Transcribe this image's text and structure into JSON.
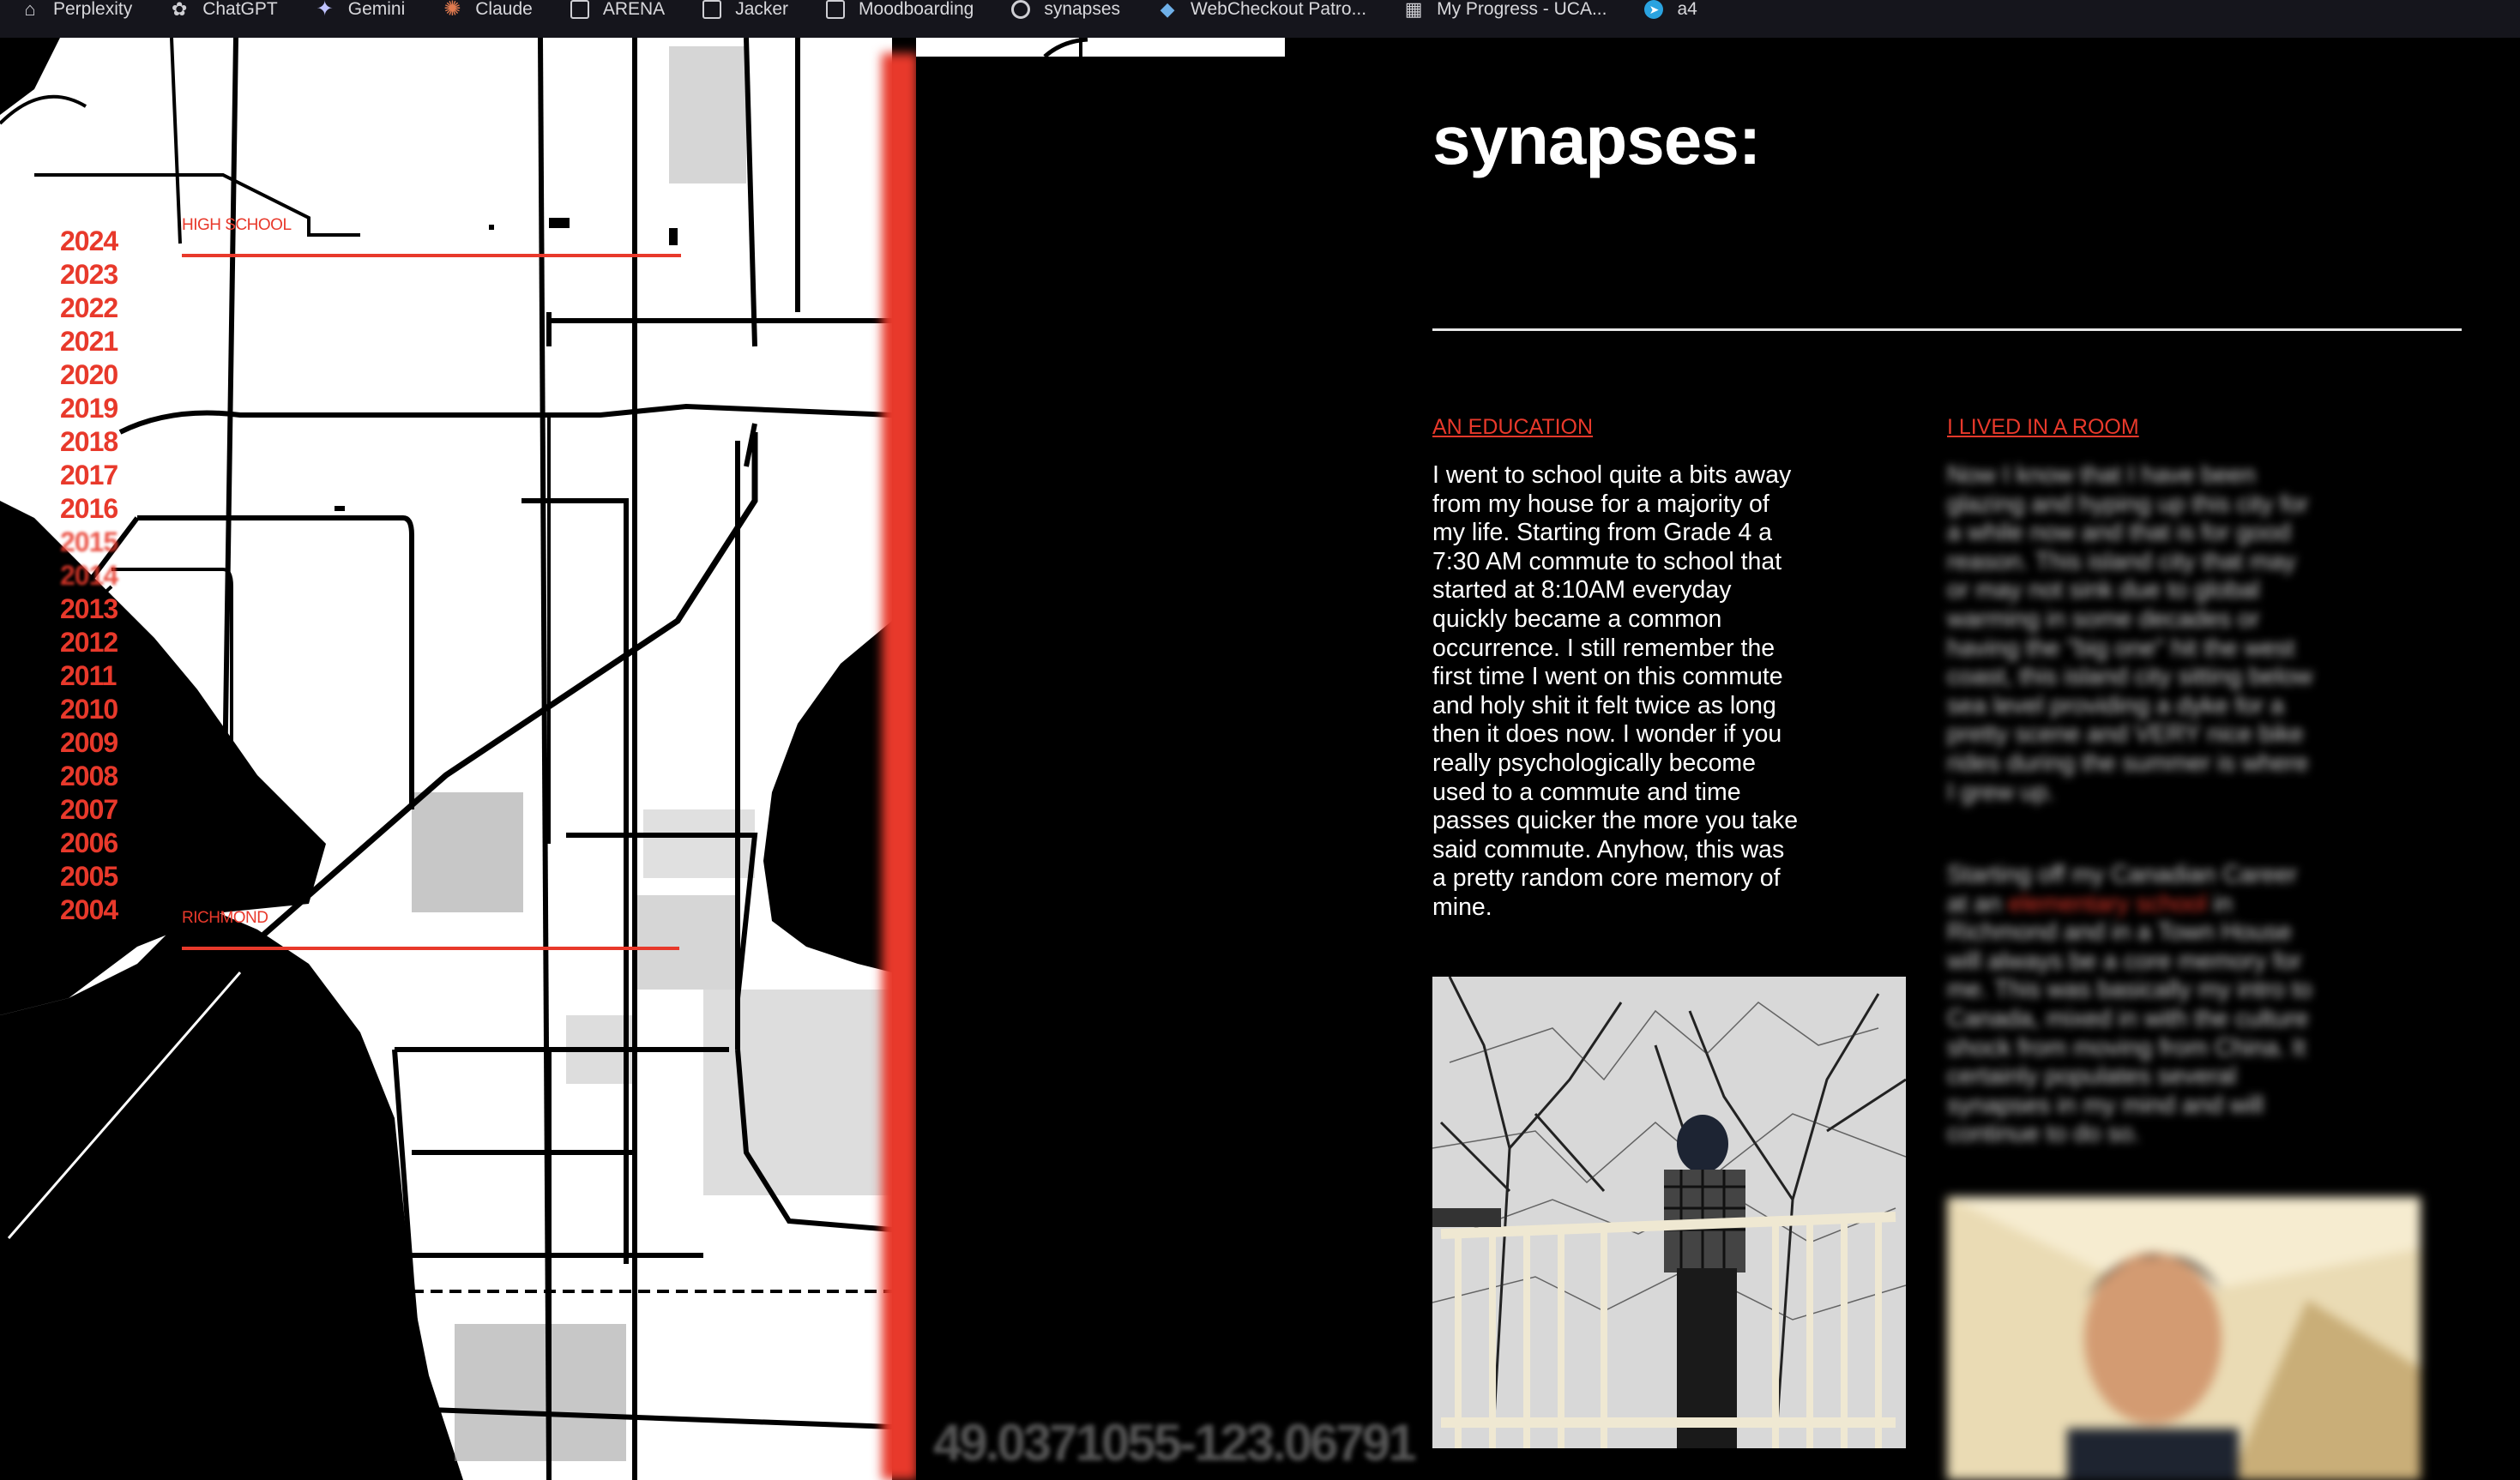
{
  "bookmarks": [
    {
      "label": "Perplexity",
      "icon": "perplexity-icon"
    },
    {
      "label": "ChatGPT",
      "icon": "chatgpt-icon"
    },
    {
      "label": "Gemini",
      "icon": "gemini-icon"
    },
    {
      "label": "Claude",
      "icon": "claude-icon"
    },
    {
      "label": "ARENA",
      "icon": "folder-icon"
    },
    {
      "label": "Jacker",
      "icon": "folder-icon"
    },
    {
      "label": "Moodboarding",
      "icon": "folder-icon"
    },
    {
      "label": "synapses",
      "icon": "loading-icon"
    },
    {
      "label": "WebCheckout Patro...",
      "icon": "webcheckout-icon"
    },
    {
      "label": "My Progress - UCA...",
      "icon": "grid-icon"
    },
    {
      "label": "a4",
      "icon": "telegram-icon"
    }
  ],
  "timeline": {
    "years": [
      "2024",
      "2023",
      "2022",
      "2021",
      "2020",
      "2019",
      "2018",
      "2017",
      "2016",
      "2015",
      "2014",
      "2013",
      "2012",
      "2011",
      "2010",
      "2009",
      "2008",
      "2007",
      "2006",
      "2005",
      "2004"
    ],
    "labels": {
      "high_school": "HIGH SCHOOL",
      "richmond": "RICHMOND"
    }
  },
  "coordinates": "49.0371055-123.06791",
  "page": {
    "title": "synapses:",
    "sections": [
      {
        "title": "AN EDUCATION",
        "body": "I went to school quite a bits away from my house for a majority of my life. Starting from Grade 4 a 7:30 AM commute to school that started at 8:10AM everyday quickly became a common occurrence. I still remember the first time I went on this commute and holy shit it felt twice as long then it does now. I wonder if you really psychologically become used to a commute and time passes quicker the more you take said commute. Anyhow, this was a pretty random core memory of mine."
      },
      {
        "title": "I LIVED IN A ROOM",
        "body_1": "Now I know that I have been glazing and hyping up this city for a while now and that is for good reason. This island city that may or may not sink due to global warming in some decades or having the \"big one\" hit the west coast, this island city sitting below sea level providing a dyke for a pretty scene and VERY nice bike rides during the summer is where I grew up.",
        "body_2_pre": "Starting off my Canadian Career at an ",
        "body_2_link": "elementary school",
        "body_2_post": " in Richmond and in a Town House will always be a core memory for me. This was basically my intro to Canada, mixed in with the culture shock from moving from China. It certainly populates several synapses in my mind and will continue to do so."
      }
    ]
  },
  "colors": {
    "accent": "#e8392b",
    "background": "#000000",
    "text": "#ffffff"
  }
}
